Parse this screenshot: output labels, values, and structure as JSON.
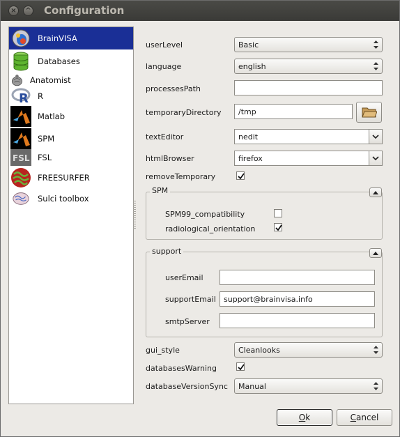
{
  "window": {
    "title": "Configuration",
    "close_glyph": "×",
    "minimize_glyph": "^"
  },
  "sidebar": {
    "items": [
      {
        "label": "BrainVISA",
        "icon": "brainvisa-icon",
        "selected": true
      },
      {
        "label": "Databases",
        "icon": "database-icon"
      },
      {
        "label": "Anatomist",
        "icon": "anatomist-icon"
      },
      {
        "label": "R",
        "icon": "r-icon"
      },
      {
        "label": "Matlab",
        "icon": "matlab-icon"
      },
      {
        "label": "SPM",
        "icon": "spm-icon"
      },
      {
        "label": "FSL",
        "icon": "fsl-icon"
      },
      {
        "label": "FREESURFER",
        "icon": "freesurfer-icon"
      },
      {
        "label": "Sulci toolbox",
        "icon": "sulci-icon"
      }
    ]
  },
  "form": {
    "userLevel": {
      "label": "userLevel",
      "value": "Basic"
    },
    "language": {
      "label": "language",
      "value": "english"
    },
    "processesPath": {
      "label": "processesPath",
      "value": ""
    },
    "temporaryDirectory": {
      "label": "temporaryDirectory",
      "value": "/tmp"
    },
    "textEditor": {
      "label": "textEditor",
      "value": "nedit"
    },
    "htmlBrowser": {
      "label": "htmlBrowser",
      "value": "firefox"
    },
    "removeTemporary": {
      "label": "removeTemporary",
      "checked": true
    },
    "spm": {
      "title": "SPM",
      "SPM99_compatibility": {
        "label": "SPM99_compatibility",
        "checked": false
      },
      "radiological_orientation": {
        "label": "radiological_orientation",
        "checked": true
      }
    },
    "support": {
      "title": "support",
      "userEmail": {
        "label": "userEmail",
        "value": ""
      },
      "supportEmail": {
        "label": "supportEmail",
        "value": "support@brainvisa.info"
      },
      "smtpServer": {
        "label": "smtpServer",
        "value": ""
      }
    },
    "gui_style": {
      "label": "gui_style",
      "value": "Cleanlooks"
    },
    "databasesWarning": {
      "label": "databasesWarning",
      "checked": true
    },
    "databaseVersionSync": {
      "label": "databaseVersionSync",
      "value": "Manual"
    }
  },
  "buttons": {
    "ok": {
      "mnemonic": "O",
      "rest": "k"
    },
    "cancel": {
      "mnemonic": "C",
      "rest": "ancel"
    }
  },
  "colors": {
    "selection": "#1a2f96",
    "titlebar": "#3f3f3c",
    "window_bg": "#eceae6"
  }
}
